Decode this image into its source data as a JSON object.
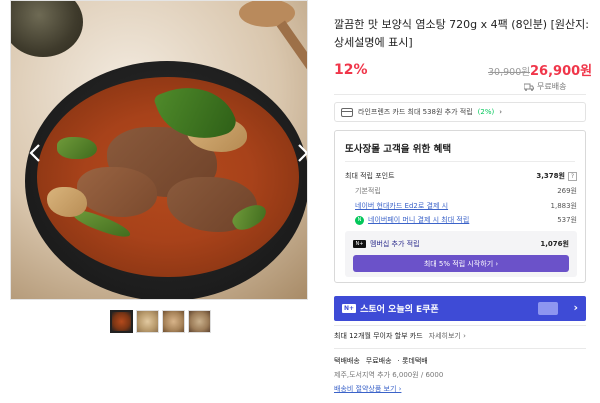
{
  "product": {
    "title": "깔끔한 맛 보양식 염소탕 720g x 4팩 (8인분) [원산지: 상세설명에 표시]",
    "discount": "12%",
    "original_price": "30,900원",
    "sale_price": "26,900원",
    "shipping": "무료배송"
  },
  "card_promo": {
    "text": "라인프렌즈 카드 최대 538원 추가 적립",
    "percent": "(2%)",
    "chevron": "›"
  },
  "benefits": {
    "title": "또사장몰 고객을 위한 혜택",
    "max_points_label": "최대 적립 포인트",
    "max_points_value": "3,378원",
    "help": "?",
    "basic_label": "기본적립",
    "basic_value": "269원",
    "naver_card_label": "네이버 현대카드 Ed2로 결제 시",
    "naver_card_value": "1,883원",
    "npay_money_label": "네이버페이 머니 결제 시 최대 적립",
    "npay_money_value": "537원",
    "npay_badge": "N",
    "pay_badge": "pay",
    "membership_badge": "N+",
    "membership_label": "멤버십 추가 적립",
    "membership_value": "1,076원",
    "membership_button": "최대 5% 적립 시작하기 ›"
  },
  "coupon": {
    "badge": "N+",
    "text": "스토어 오늘의 E쿠폰",
    "chevron": "›"
  },
  "installment": {
    "text": "최대 12개월 무이자 할부 카드",
    "more": "자세히보기 ›"
  },
  "delivery": {
    "type": "택배배송",
    "fee": "무료배송",
    "courier": "· 롯데택배",
    "extra": "제주,도서지역 추가 6,000원 / 6000",
    "link": "배송비 절약상품 보기 ›"
  },
  "colors": {
    "accent_red": "#f0364a",
    "naver_green": "#03c75a",
    "coupon_blue": "#3e4bd6",
    "membership_purple": "#6b52c9"
  }
}
